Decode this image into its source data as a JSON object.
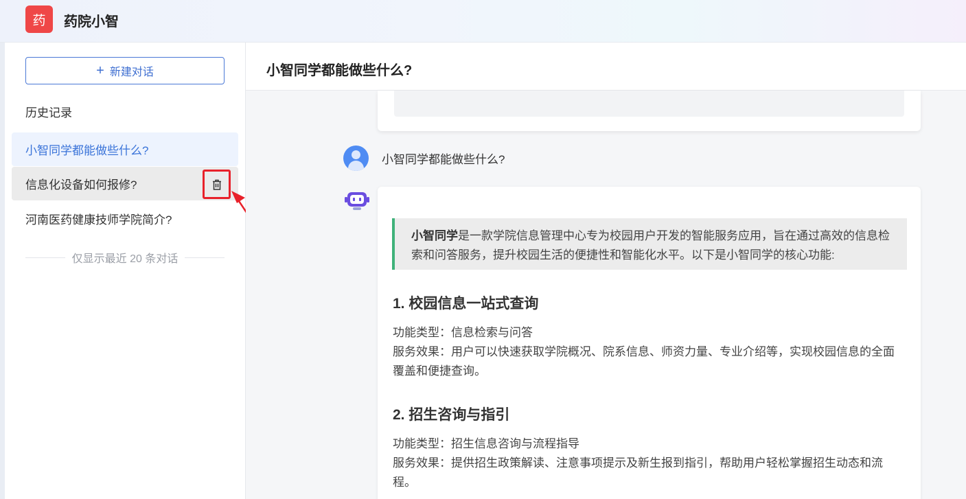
{
  "app": {
    "logo_char": "药",
    "title": "药院小智"
  },
  "sidebar": {
    "new_chat_plus": "+",
    "new_chat_label": "新建对话",
    "history_label": "历史记录",
    "items": [
      {
        "label": "小智同学都能做些什么?"
      },
      {
        "label": "信息化设备如何报修?"
      },
      {
        "label": "河南医药健康技师学院简介?"
      }
    ],
    "limit_note": "仅显示最近 20 条对话"
  },
  "main": {
    "topic_title": "小智同学都能做些什么?",
    "user_message": "小智同学都能做些什么?",
    "answer": {
      "intro_bold": "小智同学",
      "intro_rest": "是一款学院信息管理中心专为校园用户开发的智能服务应用，旨在通过高效的信息检索和问答服务，提升校园生活的便捷性和智能化水平。以下是小智同学的核心功能:",
      "sections": [
        {
          "title": "1. 校园信息一站式查询",
          "type_line": "功能类型：信息检索与问答",
          "effect_line": "服务效果：用户可以快速获取学院概况、院系信息、师资力量、专业介绍等，实现校园信息的全面覆盖和便捷查询。"
        },
        {
          "title": "2. 招生咨询与指引",
          "type_line": "功能类型：招生信息咨询与流程指导",
          "effect_line": "服务效果：提供招生政策解读、注意事项提示及新生报到指引，帮助用户轻松掌握招生动态和流程。"
        }
      ]
    }
  },
  "colors": {
    "accent": "#3b74d9",
    "logo_bg": "#ef4747",
    "highlight_border": "#e8212a",
    "quote_border": "#3fb27a",
    "bot_purple": "#6a4de0"
  },
  "icons": {
    "trash": "trash-icon",
    "user_avatar": "user-avatar-icon",
    "bot_avatar": "robot-icon"
  }
}
